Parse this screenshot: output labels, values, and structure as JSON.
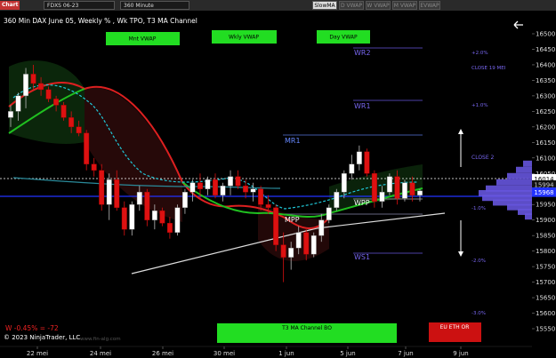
{
  "toolbar": {
    "chart_label": "Chart",
    "instrument": "FDXS 06-23",
    "interval": "360 Minute",
    "buttons": [
      "SlowMA",
      "D VWAP",
      "W VWAP",
      "M VWAP",
      "EVWAP"
    ]
  },
  "chart": {
    "title": "360 Min DAX June 05, Weekly % , Wk TPO, T3 MA Channel",
    "back_icon": "arrow-left-icon",
    "vwap_labels": [
      "Mnt VWAP",
      "Wkly VWAP",
      "Day VWAP"
    ],
    "level_labels": [
      "WR2",
      "WR1",
      "MR1",
      "CLOSE 2",
      "WPP",
      "MPP",
      "WS1"
    ],
    "pct_labels": [
      "+2.0%",
      "+1.0%",
      "-1.0%",
      "-2.0%",
      "-3.0%"
    ],
    "close_label": "CLOSE 19 MEI",
    "bottom_label": "T3 MA Channel BO",
    "eu_label": "EU ETH OR",
    "stat_text": "W -0.45% = -72",
    "copyright": "© 2023 NinjaTrader, LLC",
    "watermark": "www.fin-alg.com",
    "price_badges": [
      "16014",
      "15994",
      "15968"
    ],
    "colors": {
      "background": "#000000",
      "green_button": "#22dd22",
      "red_badge": "#cc1111",
      "level_line": "#6655dd",
      "ma_red": "#dd2020",
      "ma_green": "#20c020",
      "cyan": "#20c8d8"
    }
  },
  "chart_data": {
    "type": "candlestick",
    "x_tick_labels": [
      "22 mei",
      "24 mei",
      "26 mei",
      "30 mei",
      "1 jun",
      "5 jun",
      "7 jun",
      "9 jun"
    ],
    "y_tick_labels": [
      "16500",
      "16450",
      "16400",
      "16350",
      "16300",
      "16250",
      "16200",
      "16150",
      "16100",
      "16050",
      "16000",
      "15950",
      "15900",
      "15850",
      "15800",
      "15750",
      "15700",
      "15650",
      "15600",
      "15550"
    ],
    "ylim": [
      15530,
      16530
    ],
    "candles": [
      {
        "o": 16230,
        "h": 16270,
        "l": 16200,
        "c": 16250
      },
      {
        "o": 16250,
        "h": 16310,
        "l": 16220,
        "c": 16300
      },
      {
        "o": 16300,
        "h": 16390,
        "l": 16260,
        "c": 16370
      },
      {
        "o": 16370,
        "h": 16400,
        "l": 16320,
        "c": 16340
      },
      {
        "o": 16340,
        "h": 16360,
        "l": 16300,
        "c": 16320
      },
      {
        "o": 16320,
        "h": 16330,
        "l": 16280,
        "c": 16290
      },
      {
        "o": 16290,
        "h": 16300,
        "l": 16250,
        "c": 16270
      },
      {
        "o": 16270,
        "h": 16280,
        "l": 16220,
        "c": 16230
      },
      {
        "o": 16230,
        "h": 16250,
        "l": 16180,
        "c": 16200
      },
      {
        "o": 16200,
        "h": 16220,
        "l": 16170,
        "c": 16180
      },
      {
        "o": 16180,
        "h": 16190,
        "l": 16060,
        "c": 16080
      },
      {
        "o": 16080,
        "h": 16100,
        "l": 16040,
        "c": 16060
      },
      {
        "o": 16060,
        "h": 16080,
        "l": 15930,
        "c": 15950
      },
      {
        "o": 15950,
        "h": 16050,
        "l": 15900,
        "c": 16030
      },
      {
        "o": 16030,
        "h": 16060,
        "l": 15930,
        "c": 15940
      },
      {
        "o": 15940,
        "h": 15960,
        "l": 15850,
        "c": 15870
      },
      {
        "o": 15870,
        "h": 15960,
        "l": 15850,
        "c": 15950
      },
      {
        "o": 15950,
        "h": 16010,
        "l": 15930,
        "c": 15990
      },
      {
        "o": 15990,
        "h": 16000,
        "l": 15880,
        "c": 15900
      },
      {
        "o": 15900,
        "h": 15950,
        "l": 15870,
        "c": 15930
      },
      {
        "o": 15930,
        "h": 15940,
        "l": 15880,
        "c": 15890
      },
      {
        "o": 15890,
        "h": 15910,
        "l": 15840,
        "c": 15860
      },
      {
        "o": 15860,
        "h": 15950,
        "l": 15850,
        "c": 15940
      },
      {
        "o": 15940,
        "h": 16000,
        "l": 15920,
        "c": 15990
      },
      {
        "o": 15990,
        "h": 16030,
        "l": 15960,
        "c": 16020
      },
      {
        "o": 16020,
        "h": 16050,
        "l": 15970,
        "c": 16000
      },
      {
        "o": 16000,
        "h": 16040,
        "l": 15980,
        "c": 16030
      },
      {
        "o": 16030,
        "h": 16050,
        "l": 15970,
        "c": 15980
      },
      {
        "o": 15980,
        "h": 16020,
        "l": 15960,
        "c": 16010
      },
      {
        "o": 16010,
        "h": 16060,
        "l": 15980,
        "c": 16040
      },
      {
        "o": 16040,
        "h": 16060,
        "l": 16000,
        "c": 16010
      },
      {
        "o": 16010,
        "h": 16030,
        "l": 15970,
        "c": 15990
      },
      {
        "o": 15990,
        "h": 16020,
        "l": 15960,
        "c": 16000
      },
      {
        "o": 16000,
        "h": 16010,
        "l": 15930,
        "c": 15950
      },
      {
        "o": 15950,
        "h": 15980,
        "l": 15920,
        "c": 15940
      },
      {
        "o": 15940,
        "h": 15950,
        "l": 15800,
        "c": 15820
      },
      {
        "o": 15820,
        "h": 15860,
        "l": 15700,
        "c": 15780
      },
      {
        "o": 15780,
        "h": 15830,
        "l": 15740,
        "c": 15810
      },
      {
        "o": 15810,
        "h": 15880,
        "l": 15790,
        "c": 15860
      },
      {
        "o": 15860,
        "h": 15870,
        "l": 15770,
        "c": 15790
      },
      {
        "o": 15790,
        "h": 15860,
        "l": 15780,
        "c": 15850
      },
      {
        "o": 15850,
        "h": 15920,
        "l": 15830,
        "c": 15900
      },
      {
        "o": 15900,
        "h": 15950,
        "l": 15890,
        "c": 15940
      },
      {
        "o": 15940,
        "h": 16000,
        "l": 15930,
        "c": 15990
      },
      {
        "o": 15990,
        "h": 16060,
        "l": 15970,
        "c": 16050
      },
      {
        "o": 16050,
        "h": 16110,
        "l": 16030,
        "c": 16080
      },
      {
        "o": 16080,
        "h": 16140,
        "l": 16060,
        "c": 16120
      },
      {
        "o": 16120,
        "h": 16130,
        "l": 16040,
        "c": 16050
      },
      {
        "o": 16050,
        "h": 16060,
        "l": 15940,
        "c": 15960
      },
      {
        "o": 15960,
        "h": 16010,
        "l": 15940,
        "c": 15990
      },
      {
        "o": 15990,
        "h": 16050,
        "l": 15980,
        "c": 16040
      },
      {
        "o": 16040,
        "h": 16060,
        "l": 15950,
        "c": 15970
      },
      {
        "o": 15970,
        "h": 16030,
        "l": 15960,
        "c": 16020
      },
      {
        "o": 16020,
        "h": 16040,
        "l": 15960,
        "c": 15980
      },
      {
        "o": 15980,
        "h": 16000,
        "l": 15960,
        "c": 15994
      }
    ]
  }
}
